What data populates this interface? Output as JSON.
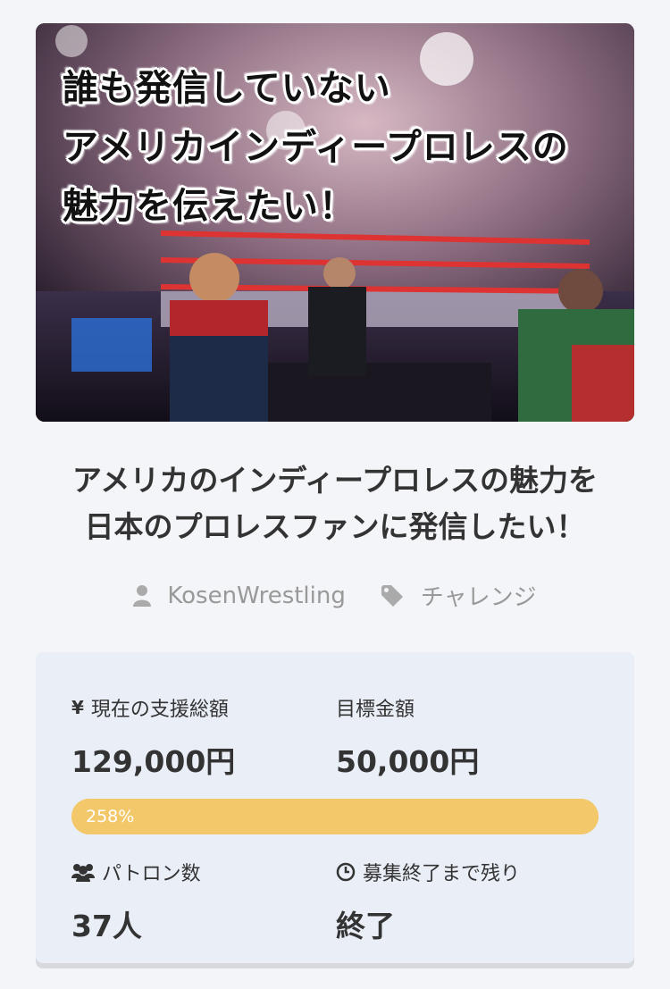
{
  "hero": {
    "caption_lines": [
      "誰も発信していない",
      "アメリカインディープロレスの",
      "魅力を伝えたい！"
    ]
  },
  "project": {
    "title_line1": "アメリカのインディープロレスの魅力を",
    "title_line2": "日本のプロレスファンに発信したい！",
    "author": "KosenWrestling",
    "category": "チャレンジ"
  },
  "stats": {
    "current_label": "現在の支援総額",
    "current_value": "129,000円",
    "goal_label": "目標金額",
    "goal_value": "50,000円",
    "progress_text": "258%",
    "progress_fraction": 1.0,
    "patrons_label": "パトロン数",
    "patrons_value": "37人",
    "remaining_label": "募集終了まで残り",
    "remaining_value": "終了"
  },
  "colors": {
    "progress": "#f2c86a",
    "card_bg": "#e9eef7",
    "meta_text": "#999999"
  },
  "icons": {
    "currency": "yen-icon",
    "author": "user-icon",
    "category": "tag-icon",
    "patrons": "users-icon",
    "time": "clock-icon"
  }
}
